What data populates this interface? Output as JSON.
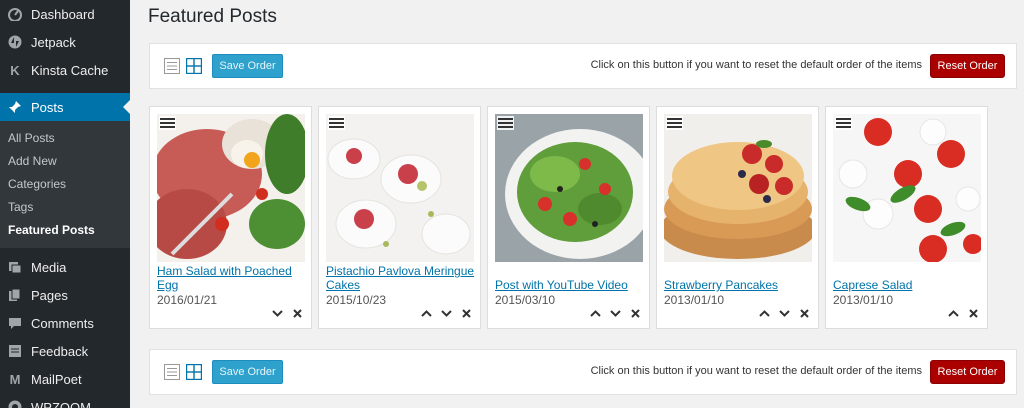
{
  "sidebar": {
    "top_items": [
      {
        "label": "Dashboard",
        "icon": "dashboard-icon"
      },
      {
        "label": "Jetpack",
        "icon": "jetpack-icon"
      },
      {
        "label": "Kinsta Cache",
        "icon": "kinsta-icon"
      }
    ],
    "active_item": {
      "label": "Posts",
      "icon": "pin-icon"
    },
    "submenu": [
      "All Posts",
      "Add New",
      "Categories",
      "Tags",
      "Featured Posts"
    ],
    "bottom_items": [
      {
        "label": "Media",
        "icon": "media-icon"
      },
      {
        "label": "Pages",
        "icon": "pages-icon"
      },
      {
        "label": "Comments",
        "icon": "comments-icon"
      },
      {
        "label": "Feedback",
        "icon": "feedback-icon"
      },
      {
        "label": "MailPoet",
        "icon": "mailpoet-icon"
      },
      {
        "label": "WPZOOM",
        "icon": "wpzoom-icon"
      }
    ]
  },
  "page": {
    "title": "Featured Posts"
  },
  "toolbar": {
    "save_label": "Save Order",
    "reset_hint": "Click on this button if you want to reset the default order of the items",
    "reset_label": "Reset Order"
  },
  "posts": [
    {
      "title": "Ham Salad with Poached Egg",
      "date": "2016/01/21"
    },
    {
      "title": "Pistachio Pavlova Meringue Cakes",
      "date": "2015/10/23"
    },
    {
      "title": "Post with YouTube Video",
      "date": "2015/03/10"
    },
    {
      "title": "Strawberry Pancakes",
      "date": "2013/01/10"
    },
    {
      "title": "Caprese Salad",
      "date": "2013/01/10"
    }
  ],
  "colors": {
    "sidebar_bg": "#23282d",
    "active_blue": "#0073aa",
    "save_button": "#2ea2cc",
    "reset_button": "#aa0000",
    "link": "#0073aa"
  }
}
